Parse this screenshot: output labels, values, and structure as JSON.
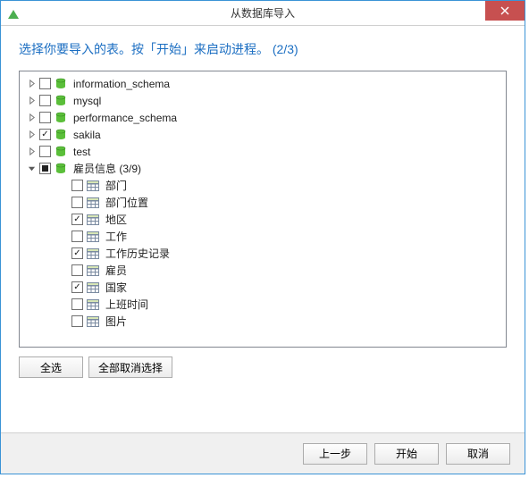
{
  "window": {
    "title": "从数据库导入"
  },
  "header": {
    "text": "选择你要导入的表。按「开始」来启动进程。 (2/3)"
  },
  "tree": {
    "databases": [
      {
        "label": "information_schema",
        "checked": false,
        "expanded": false,
        "indeterminate": false
      },
      {
        "label": "mysql",
        "checked": false,
        "expanded": false,
        "indeterminate": false
      },
      {
        "label": "performance_schema",
        "checked": false,
        "expanded": false,
        "indeterminate": false
      },
      {
        "label": "sakila",
        "checked": true,
        "expanded": false,
        "indeterminate": false
      },
      {
        "label": "test",
        "checked": false,
        "expanded": false,
        "indeterminate": false
      },
      {
        "label": "雇员信息 (3/9)",
        "checked": false,
        "indeterminate": true,
        "expanded": true,
        "tables": [
          {
            "label": "部门",
            "checked": false
          },
          {
            "label": "部门位置",
            "checked": false
          },
          {
            "label": "地区",
            "checked": true
          },
          {
            "label": "工作",
            "checked": false
          },
          {
            "label": "工作历史记录",
            "checked": true
          },
          {
            "label": "雇员",
            "checked": false
          },
          {
            "label": "国家",
            "checked": true
          },
          {
            "label": "上班时间",
            "checked": false
          },
          {
            "label": "图片",
            "checked": false
          }
        ]
      }
    ]
  },
  "buttons": {
    "select_all": "全选",
    "deselect_all": "全部取消选择",
    "back": "上一步",
    "start": "开始",
    "cancel": "取消"
  },
  "colors": {
    "accent": "#1b6ec2",
    "close_bg": "#c75050",
    "border": "#3a93d6"
  }
}
